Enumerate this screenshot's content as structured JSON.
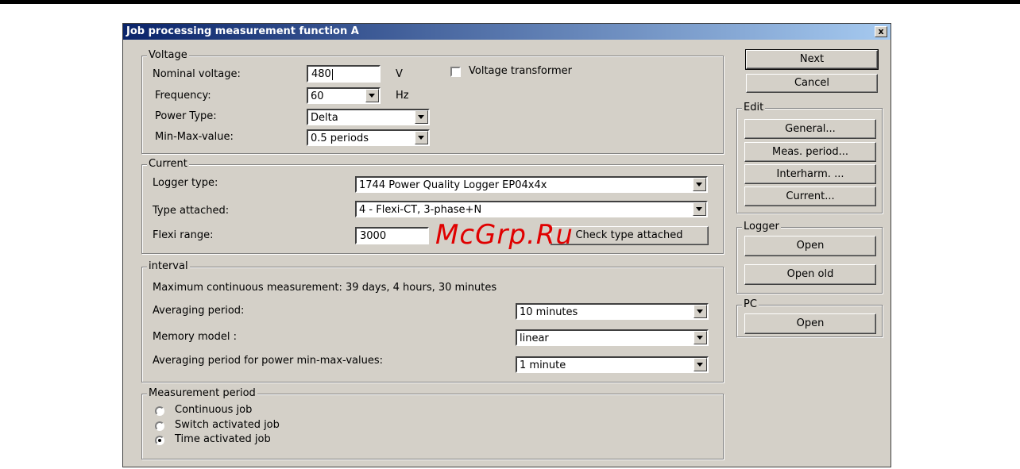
{
  "window": {
    "title": "Job processing measurement function A",
    "close_label": "x"
  },
  "voltage": {
    "legend": "Voltage",
    "nominal_label": "Nominal voltage:",
    "nominal_value": "480",
    "nominal_unit": "V",
    "transformer_label": "Voltage transformer",
    "frequency_label": "Frequency:",
    "frequency_value": "60",
    "frequency_unit": "Hz",
    "power_type_label": "Power Type:",
    "power_type_value": "Delta",
    "minmax_label": "Min-Max-value:",
    "minmax_value": "0.5 periods"
  },
  "current": {
    "legend": "Current",
    "logger_type_label": "Logger type:",
    "logger_type_value": "1744 Power Quality Logger  EP04x4x",
    "type_attached_label": "Type attached:",
    "type_attached_value": "4   - Flexi-CT, 3-phase+N",
    "flexi_range_label": "Flexi range:",
    "flexi_range_value": "3000",
    "check_button": "Check type attached"
  },
  "interval": {
    "legend": "interval",
    "max_continuous": "Maximum continuous measurement: 39 days, 4 hours, 30 minutes",
    "averaging_label": "Averaging period:",
    "averaging_value": "10 minutes",
    "memory_label": "Memory model :",
    "memory_value": "linear",
    "power_avg_label": "Averaging period for power min-max-values:",
    "power_avg_value": "1 minute"
  },
  "measurement_period": {
    "legend": "Measurement period",
    "options": [
      "Continuous job",
      "Switch activated job",
      "Time activated job"
    ],
    "selected_index": 2
  },
  "buttons": {
    "next": "Next",
    "cancel": "Cancel"
  },
  "edit": {
    "legend": "Edit",
    "general": "General...",
    "meas_period": "Meas. period...",
    "interharm": "Interharm. ...",
    "current": "Current..."
  },
  "logger": {
    "legend": "Logger",
    "open": "Open",
    "open_old": "Open old"
  },
  "pc": {
    "legend": "PC",
    "open": "Open"
  },
  "watermark": "McGrp.Ru",
  "colors": {
    "title_start": "#0a246a",
    "title_end": "#a6caf0",
    "dialog_bg": "#d4d0c8",
    "watermark": "#e00000"
  }
}
